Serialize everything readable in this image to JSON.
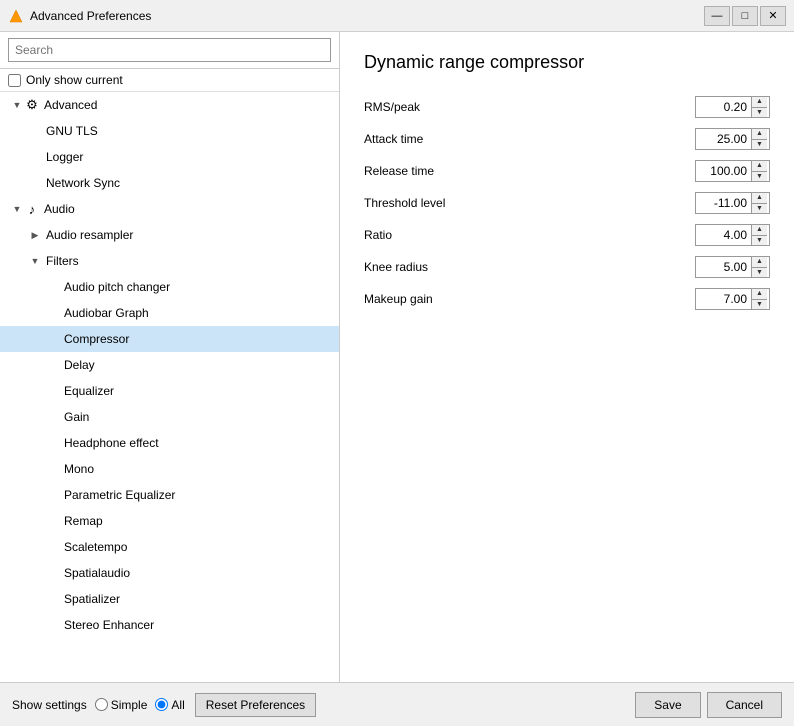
{
  "window": {
    "title": "Advanced Preferences",
    "icon": "🎭",
    "controls": {
      "minimize": "—",
      "maximize": "□",
      "close": "✕"
    }
  },
  "left_panel": {
    "search_placeholder": "Search",
    "only_show_current_label": "Only show current",
    "tree": [
      {
        "id": "advanced",
        "level": 0,
        "toggle": "▼",
        "icon": "⚙",
        "label": "Advanced",
        "expanded": true,
        "selected": false
      },
      {
        "id": "gnu-tls",
        "level": 1,
        "toggle": "",
        "icon": "",
        "label": "GNU TLS",
        "selected": false
      },
      {
        "id": "logger",
        "level": 1,
        "toggle": "",
        "icon": "",
        "label": "Logger",
        "selected": false
      },
      {
        "id": "network-sync",
        "level": 1,
        "toggle": "",
        "icon": "",
        "label": "Network Sync",
        "selected": false
      },
      {
        "id": "audio",
        "level": 0,
        "toggle": "▼",
        "icon": "♪",
        "label": "Audio",
        "expanded": true,
        "selected": false
      },
      {
        "id": "audio-resampler",
        "level": 1,
        "toggle": "▶",
        "icon": "",
        "label": "Audio resampler",
        "selected": false
      },
      {
        "id": "filters",
        "level": 1,
        "toggle": "▼",
        "icon": "",
        "label": "Filters",
        "expanded": true,
        "selected": false
      },
      {
        "id": "audio-pitch-changer",
        "level": 2,
        "toggle": "",
        "icon": "",
        "label": "Audio pitch changer",
        "selected": false
      },
      {
        "id": "audiobar-graph",
        "level": 2,
        "toggle": "",
        "icon": "",
        "label": "Audiobar Graph",
        "selected": false
      },
      {
        "id": "compressor",
        "level": 2,
        "toggle": "",
        "icon": "",
        "label": "Compressor",
        "selected": true
      },
      {
        "id": "delay",
        "level": 2,
        "toggle": "",
        "icon": "",
        "label": "Delay",
        "selected": false
      },
      {
        "id": "equalizer",
        "level": 2,
        "toggle": "",
        "icon": "",
        "label": "Equalizer",
        "selected": false
      },
      {
        "id": "gain",
        "level": 2,
        "toggle": "",
        "icon": "",
        "label": "Gain",
        "selected": false
      },
      {
        "id": "headphone-effect",
        "level": 2,
        "toggle": "",
        "icon": "",
        "label": "Headphone effect",
        "selected": false
      },
      {
        "id": "mono",
        "level": 2,
        "toggle": "",
        "icon": "",
        "label": "Mono",
        "selected": false
      },
      {
        "id": "parametric-equalizer",
        "level": 2,
        "toggle": "",
        "icon": "",
        "label": "Parametric Equalizer",
        "selected": false
      },
      {
        "id": "remap",
        "level": 2,
        "toggle": "",
        "icon": "",
        "label": "Remap",
        "selected": false
      },
      {
        "id": "scaletempo",
        "level": 2,
        "toggle": "",
        "icon": "",
        "label": "Scaletempo",
        "selected": false
      },
      {
        "id": "spatialaudio",
        "level": 2,
        "toggle": "",
        "icon": "",
        "label": "Spatialaudio",
        "selected": false
      },
      {
        "id": "spatializer",
        "level": 2,
        "toggle": "",
        "icon": "",
        "label": "Spatializer",
        "selected": false
      },
      {
        "id": "stereo-enhancer",
        "level": 2,
        "toggle": "",
        "icon": "",
        "label": "Stereo Enhancer",
        "selected": false
      }
    ]
  },
  "right_panel": {
    "title": "Dynamic range compressor",
    "fields": [
      {
        "id": "rms-peak",
        "label": "RMS/peak",
        "value": "0.20"
      },
      {
        "id": "attack-time",
        "label": "Attack time",
        "value": "25.00"
      },
      {
        "id": "release-time",
        "label": "Release time",
        "value": "100.00"
      },
      {
        "id": "threshold-level",
        "label": "Threshold level",
        "value": "-11.00"
      },
      {
        "id": "ratio",
        "label": "Ratio",
        "value": "4.00"
      },
      {
        "id": "knee-radius",
        "label": "Knee radius",
        "value": "5.00"
      },
      {
        "id": "makeup-gain",
        "label": "Makeup gain",
        "value": "7.00"
      }
    ]
  },
  "bottom_bar": {
    "show_settings_label": "Show settings",
    "radio_simple": "Simple",
    "radio_all": "All",
    "reset_btn": "Reset Preferences",
    "save_btn": "Save",
    "cancel_btn": "Cancel"
  }
}
